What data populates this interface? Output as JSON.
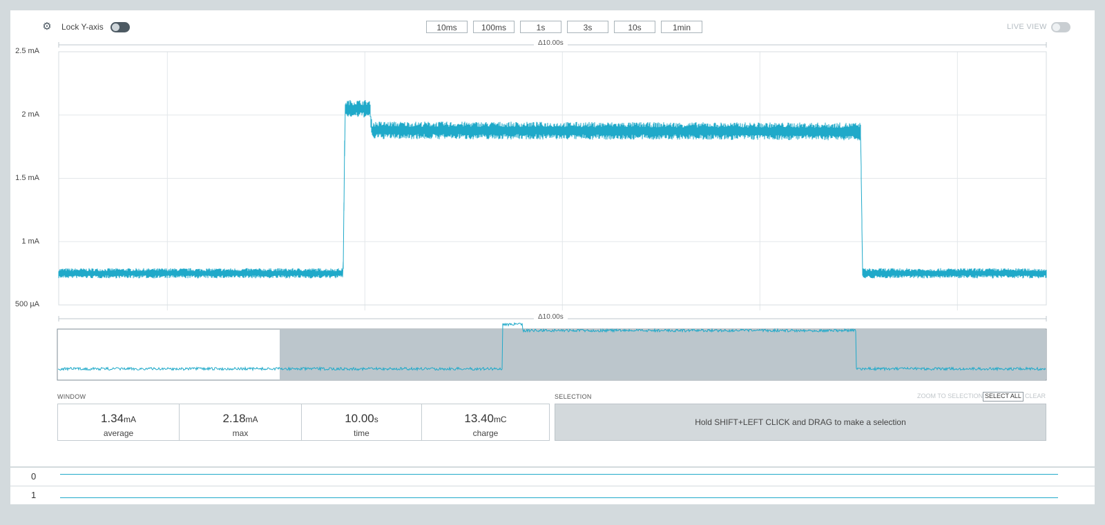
{
  "toolbar": {
    "settings_icon": "gear-icon",
    "lock_y_axis_label": "Lock Y-axis",
    "lock_y_axis_on": true,
    "zoom_buttons": [
      "10ms",
      "100ms",
      "1s",
      "3s",
      "10s",
      "1min"
    ],
    "live_view_label": "LIVE VIEW",
    "live_view_on": false
  },
  "chart": {
    "delta_top": "Δ10.00s",
    "delta_bottom": "Δ10.00s",
    "y_ticks": [
      "2.5 mA",
      "2 mA",
      "1.5 mA",
      "1 mA",
      "500 µA"
    ],
    "series_color": "#1fa9c9"
  },
  "chart_data": {
    "type": "line",
    "title": "",
    "xlabel": "",
    "ylabel": "",
    "ylim": [
      0.5,
      2.5
    ],
    "y_ticks": [
      "2.5 mA",
      "2 mA",
      "1.5 mA",
      "1 mA",
      "500 µA"
    ],
    "grid": true,
    "series": [
      {
        "points": [
          {
            "t": 0.0,
            "mA": 0.75
          },
          {
            "t": 2.88,
            "mA": 0.75
          },
          {
            "t": 2.9,
            "mA": 2.05
          },
          {
            "t": 3.15,
            "mA": 2.05
          },
          {
            "t": 3.17,
            "mA": 1.88
          },
          {
            "t": 8.12,
            "mA": 1.87
          },
          {
            "t": 8.14,
            "mA": 0.75
          },
          {
            "t": 10.0,
            "mA": 0.75
          }
        ]
      }
    ]
  },
  "window": {
    "section_label": "WINDOW",
    "stats": [
      {
        "value": "1.34",
        "unit": "mA",
        "label": "average"
      },
      {
        "value": "2.18",
        "unit": "mA",
        "label": "max"
      },
      {
        "value": "10.00",
        "unit": "s",
        "label": "time"
      },
      {
        "value": "13.40",
        "unit": "mC",
        "label": "charge"
      }
    ]
  },
  "selection": {
    "section_label": "SELECTION",
    "zoom_to_selection": "ZOOM TO SELECTION",
    "select_all": "SELECT ALL",
    "clear": "CLEAR",
    "hint": "Hold SHIFT+LEFT CLICK and DRAG to make a selection"
  },
  "digital_channels": [
    {
      "label": "0"
    },
    {
      "label": "1"
    }
  ]
}
